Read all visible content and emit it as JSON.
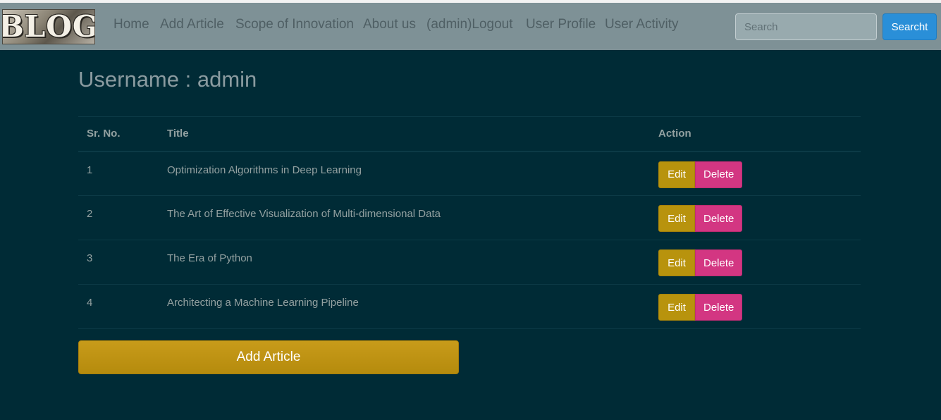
{
  "navbar": {
    "logo_text": "BLOG",
    "links": [
      "Home",
      "Add Article",
      "Scope of Innovation",
      "About us",
      "(admin)Logout",
      "User Profile",
      "User Activity"
    ],
    "search_placeholder": "Search",
    "search_button": "Searcht"
  },
  "page": {
    "title": "Username : admin"
  },
  "table": {
    "headers": [
      "Sr. No.",
      "Title",
      "Action"
    ],
    "rows": [
      {
        "sr": "1",
        "title": "Optimization Algorithms in Deep Learning",
        "edit": "Edit",
        "delete": "Delete"
      },
      {
        "sr": "2",
        "title": "The Art of Effective Visualization of Multi-dimensional Data",
        "edit": "Edit",
        "delete": "Delete"
      },
      {
        "sr": "3",
        "title": "The Era of Python",
        "edit": "Edit",
        "delete": "Delete"
      },
      {
        "sr": "4",
        "title": "Architecting a Machine Learning Pipeline",
        "edit": "Edit",
        "delete": "Delete"
      }
    ]
  },
  "add_article_button": "Add Article",
  "colors": {
    "background": "#002b36",
    "navbar": "#7e9196",
    "edit": "#b8930d",
    "delete": "#d33682",
    "search_button": "#2a8fd8"
  }
}
